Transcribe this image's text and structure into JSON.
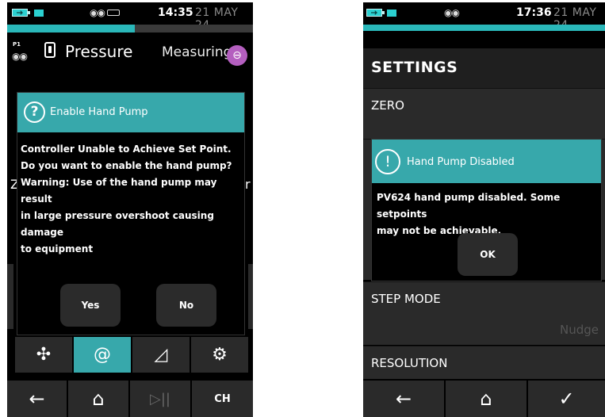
{
  "screen1": {
    "statusbar": {
      "time": "14:35",
      "date": "21 MAY 24",
      "dots_icon": "circles-icon"
    },
    "progress_pct": 52,
    "header": {
      "port_label": "P1",
      "title": "Pressure",
      "status": "Measuring"
    },
    "background_fragments": {
      "left": "Z",
      "right": "r"
    },
    "dialog": {
      "title": "Enable Hand Pump",
      "icon": "?",
      "lines": [
        "Controller Unable to Achieve Set Point.",
        "Do you want to enable the hand pump?",
        "Warning: Use of the hand pump may result",
        "in large pressure overshoot causing damage",
        "to equipment"
      ],
      "yes_label": "Yes",
      "no_label": "No"
    },
    "tools": [
      "fan-icon",
      "pump-icon",
      "gauge-icon",
      "gear-icon"
    ],
    "nav": {
      "play_pause": "▷||",
      "channel": "CH"
    }
  },
  "screen2": {
    "statusbar": {
      "time": "17:36",
      "date": "21 MAY 24"
    },
    "title": "SETTINGS",
    "rows": {
      "zero": "ZERO",
      "step_mode": "STEP MODE",
      "step_mode_value": "Nudge",
      "resolution": "RESOLUTION"
    },
    "dialog": {
      "title": "Hand Pump Disabled",
      "icon": "!",
      "lines": [
        "PV624 hand pump disabled. Some setpoints",
        "may not be achievable."
      ],
      "ok_label": "OK"
    }
  },
  "colors": {
    "accent": "#37a8ab",
    "status_badge": "#b45fbf",
    "button_bg": "#2a2a2a"
  }
}
